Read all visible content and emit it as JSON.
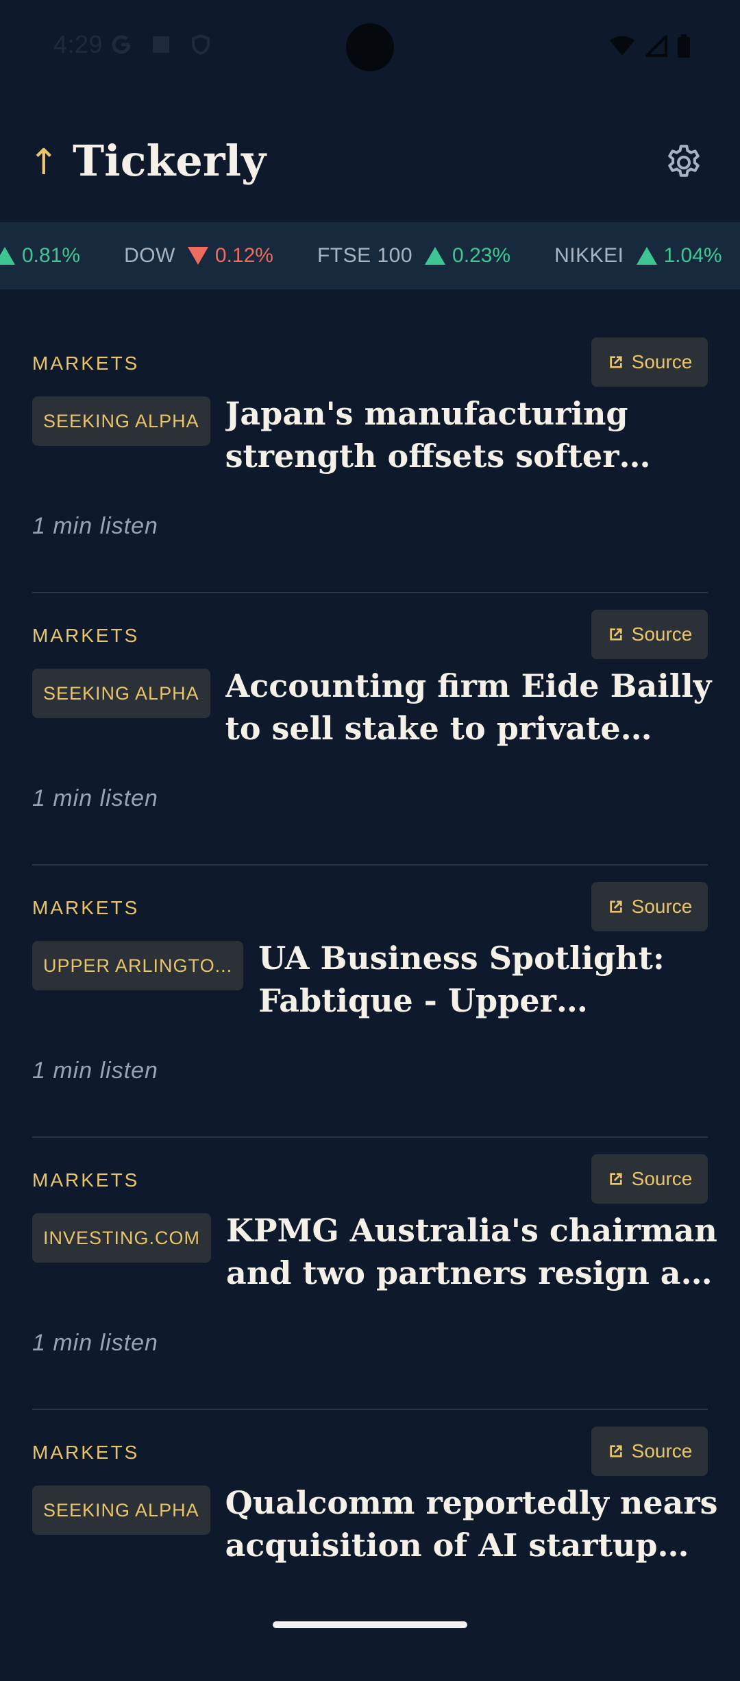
{
  "status": {
    "time": "4:29"
  },
  "app": {
    "title": "Tickerly",
    "logo_arrow": "↑"
  },
  "ticker": [
    {
      "name": "",
      "direction": "up",
      "change": "0.81%"
    },
    {
      "name": "DOW",
      "direction": "down",
      "change": "0.12%"
    },
    {
      "name": "FTSE 100",
      "direction": "up",
      "change": "0.23%"
    },
    {
      "name": "NIKKEI",
      "direction": "up",
      "change": "1.04%"
    }
  ],
  "articles": [
    {
      "category": "MARKETS",
      "source_label": "Source",
      "publisher": "SEEKING ALPHA",
      "headline": "Japan's manufacturing strength offsets softer services",
      "listen": "1 min listen"
    },
    {
      "category": "MARKETS",
      "source_label": "Source",
      "publisher": "SEEKING ALPHA",
      "headline": "Accounting firm Eide Bailly to sell stake to private equity",
      "listen": "1 min listen"
    },
    {
      "category": "MARKETS",
      "source_label": "Source",
      "publisher": "UPPER ARLINGTO...",
      "headline": "UA Business Spotlight: Fabtique - Upper Arlington",
      "listen": "1 min listen"
    },
    {
      "category": "MARKETS",
      "source_label": "Source",
      "publisher": "INVESTING.COM",
      "headline": "KPMG Australia's chairman and two partners resign as a",
      "listen": "1 min listen"
    },
    {
      "category": "MARKETS",
      "source_label": "Source",
      "publisher": "SEEKING ALPHA",
      "headline": "Qualcomm reportedly nears acquisition of AI startup Mo",
      "listen": ""
    }
  ],
  "colors": {
    "accent": "#e9c46a",
    "up": "#3ec792",
    "down": "#ef6b5d",
    "background": "#0e1a2b"
  }
}
